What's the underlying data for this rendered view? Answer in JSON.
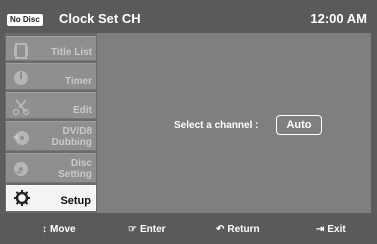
{
  "header": {
    "disc_status": "No Disc",
    "title": "Clock Set CH",
    "time": "12:00 AM"
  },
  "sidebar": {
    "items": [
      {
        "label": "Title List",
        "icon": "film-reel-icon",
        "active": false
      },
      {
        "label": "Timer",
        "icon": "timer-icon",
        "active": false
      },
      {
        "label": "Edit",
        "icon": "scissors-icon",
        "active": false
      },
      {
        "label": "DV/D8\nDubbing",
        "icon": "dubbing-icon",
        "active": false
      },
      {
        "label": "Disc\nSetting",
        "icon": "disc-icon",
        "active": false
      },
      {
        "label": "Setup",
        "icon": "gear-icon",
        "active": true
      }
    ]
  },
  "main": {
    "prompt": "Select a channel :",
    "channel_value": "Auto"
  },
  "footer": {
    "move": {
      "glyph": "↕",
      "label": "Move"
    },
    "enter": {
      "glyph": "☞",
      "label": "Enter"
    },
    "return": {
      "glyph": "↶",
      "label": "Return"
    },
    "exit": {
      "glyph": "⇥",
      "label": "Exit"
    }
  },
  "colors": {
    "background": "#5c5c5c",
    "panel": "#7f7f7f",
    "active_item": "#f4f4f4",
    "text": "#ffffff"
  }
}
